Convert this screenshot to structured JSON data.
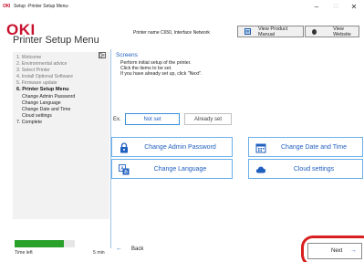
{
  "window": {
    "icon_text": "OKI",
    "title": "Setup -Printer Setup Menu-",
    "minimize": "–",
    "maximize": "□",
    "close": "✕"
  },
  "header": {
    "logo": "OKI",
    "app_title": "Printer Setup Menu",
    "printer_name": "Printer name C650, Interface Network",
    "view_manual_label": "View Product Manual",
    "view_website_label": "View Website"
  },
  "sidebar": {
    "steps": [
      {
        "label": "1. Welcome",
        "state": "done"
      },
      {
        "label": "2. Environmental advice",
        "state": "done"
      },
      {
        "label": "3. Select Printer",
        "state": "done"
      },
      {
        "label": "4. Install Optional Software",
        "state": "done"
      },
      {
        "label": "5. Firmware update",
        "state": "done"
      },
      {
        "label": "6. Printer Setup Menu",
        "state": "active"
      },
      {
        "label": "7. Complete",
        "state": "pending"
      }
    ],
    "substeps": [
      "Change Admin Password",
      "Change Language",
      "Change Date and Time",
      "Cloud settings"
    ],
    "progress": 0.82,
    "progress_color": "#2aa12a",
    "time_label": "Time left",
    "time_value": "5 min"
  },
  "main": {
    "section_title": "Screens",
    "instructions": [
      "Perform initial setup of the printer.",
      "Click the items to be set.",
      "If you have already set up, click \"Next\"."
    ],
    "legend_prefix": "Ex.",
    "legend_not_set": "Not set",
    "legend_already_set": "Already set",
    "buttons": {
      "admin_password": {
        "label": "Change Admin Password",
        "icon": "lock-icon"
      },
      "date_time": {
        "label": "Change Date and Time",
        "icon": "calendar-icon"
      },
      "language": {
        "label": "Change Language",
        "icon": "language-icon"
      },
      "cloud": {
        "label": "Cloud settings",
        "icon": "cloud-icon"
      }
    }
  },
  "footer": {
    "back_label": "Back",
    "next_label": "Next"
  },
  "colors": {
    "accent": "#1f5fbf",
    "brand": "#c8102e",
    "highlight": "#d81f1f"
  }
}
